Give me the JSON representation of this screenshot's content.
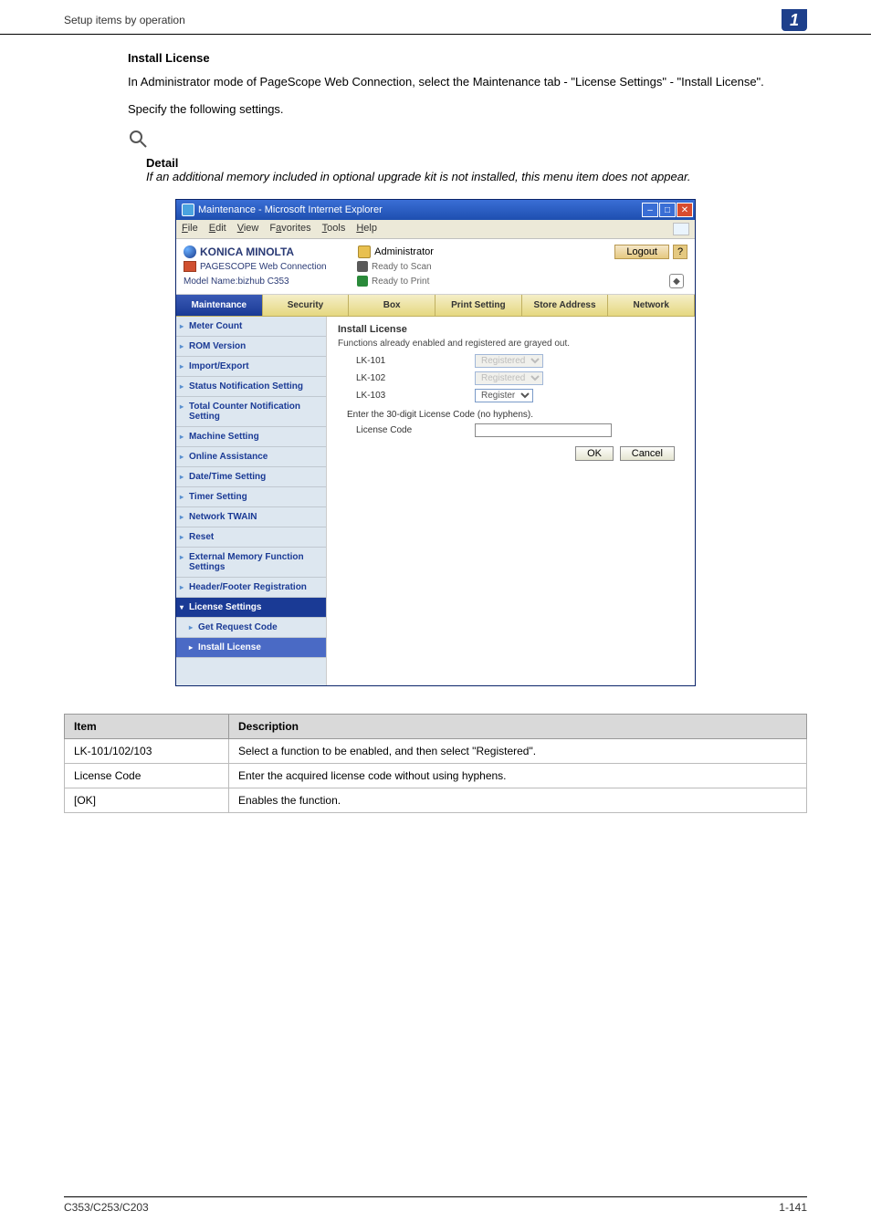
{
  "header": {
    "breadcrumb": "Setup items by operation",
    "section_number": "1"
  },
  "section": {
    "title": "Install License",
    "p1": "In Administrator mode of PageScope Web Connection, select the Maintenance tab - \"License Settings\" - \"Install License\".",
    "p2": "Specify the following settings.",
    "detail_label": "Detail",
    "detail_text": "If an additional memory included in optional upgrade kit is not installed, this menu item does not appear."
  },
  "browser": {
    "title": "Maintenance - Microsoft Internet Explorer",
    "menu": {
      "file": "File",
      "edit": "Edit",
      "view": "View",
      "favorites": "Favorites",
      "tools": "Tools",
      "help": "Help"
    },
    "km_brand": "KONICA MINOLTA",
    "administrator": "Administrator",
    "logout": "Logout",
    "help": "?",
    "pagescope": "PAGESCOPE Web Connection",
    "model": "Model Name:bizhub C353",
    "ready_scan": "Ready to Scan",
    "ready_print": "Ready to Print"
  },
  "tabs": {
    "maintenance": "Maintenance",
    "security": "Security",
    "box": "Box",
    "print_setting": "Print Setting",
    "store_address": "Store Address",
    "network": "Network"
  },
  "sidebar": {
    "items": [
      {
        "label": "Meter Count"
      },
      {
        "label": "ROM Version"
      },
      {
        "label": "Import/Export"
      },
      {
        "label": "Status Notification Setting"
      },
      {
        "label": "Total Counter Notification Setting"
      },
      {
        "label": "Machine Setting"
      },
      {
        "label": "Online Assistance"
      },
      {
        "label": "Date/Time Setting"
      },
      {
        "label": "Timer Setting"
      },
      {
        "label": "Network TWAIN"
      },
      {
        "label": "Reset"
      },
      {
        "label": "External Memory Function Settings"
      },
      {
        "label": "Header/Footer Registration"
      }
    ],
    "license_settings": "License Settings",
    "get_request_code": "Get Request Code",
    "install_license": "Install License"
  },
  "panel": {
    "heading": "Install License",
    "grayed_note": "Functions already enabled and registered are grayed out.",
    "rows": [
      {
        "label": "LK-101",
        "selected": "Registered",
        "disabled": true
      },
      {
        "label": "LK-102",
        "selected": "Registered",
        "disabled": true
      },
      {
        "label": "LK-103",
        "selected": "Register",
        "disabled": false
      }
    ],
    "enter_note": "Enter the 30-digit License Code (no hyphens).",
    "license_code_label": "License Code",
    "license_code_value": "",
    "ok": "OK",
    "cancel": "Cancel"
  },
  "desc_table": {
    "col_item": "Item",
    "col_desc": "Description",
    "rows": [
      {
        "item": "LK-101/102/103",
        "desc": "Select a function to be enabled, and then select \"Registered\"."
      },
      {
        "item": "License Code",
        "desc": "Enter the acquired license code without using hyphens."
      },
      {
        "item": "[OK]",
        "desc": "Enables the function."
      }
    ]
  },
  "footer": {
    "left": "C353/C253/C203",
    "right": "1-141"
  }
}
